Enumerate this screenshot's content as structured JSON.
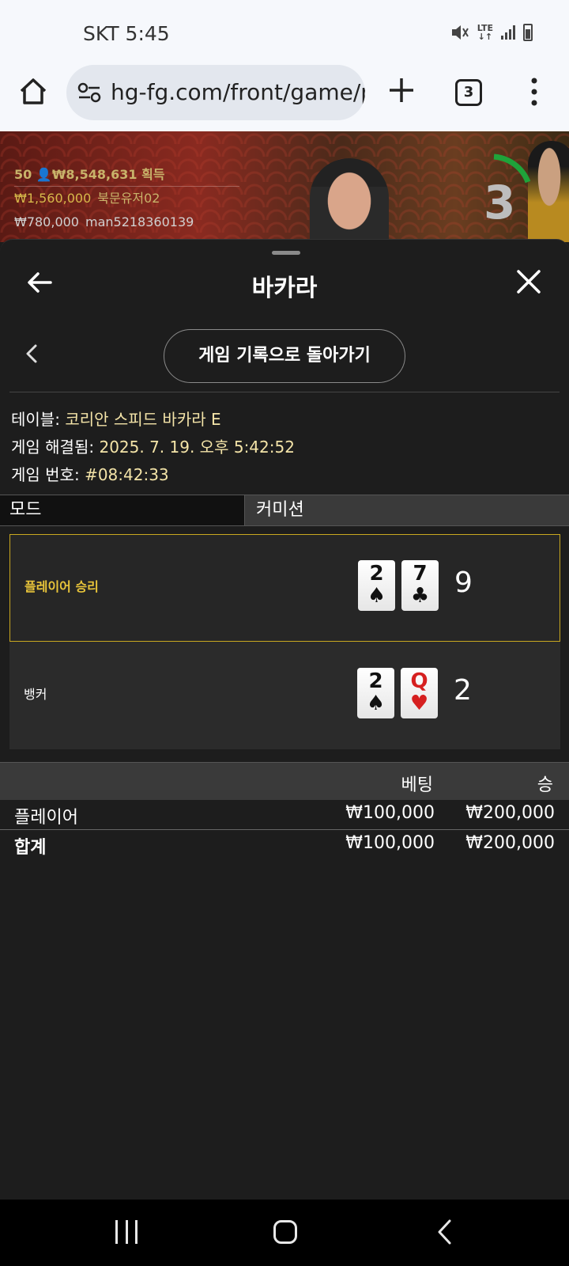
{
  "status": {
    "carrier_time": "SKT 5:45",
    "network": "LTE"
  },
  "browser": {
    "url": "hg-fg.com/front/game/p",
    "tab_count": "3"
  },
  "video": {
    "winners_total_count": "50",
    "winners_total_amount": "₩8,548,631",
    "winners_total_label": "획득",
    "winners": [
      {
        "amount": "₩1,560,000",
        "name": "북문유저02"
      },
      {
        "amount": "₩780,000",
        "name": "man5218360139"
      }
    ],
    "timer": "3"
  },
  "sheet": {
    "title": "바카라",
    "history_button": "게임 기록으로 돌아가기",
    "info": {
      "table_label": "테이블:",
      "table_value": "코리안 스피드 바카라 E",
      "resolved_label": "게임 해결됨:",
      "resolved_value": "2025. 7. 19. 오후 5:42:52",
      "number_label": "게임 번호:",
      "number_value": "#08:42:33"
    },
    "tabs": {
      "mode": "모드",
      "commission": "커미션"
    },
    "hands": {
      "player": {
        "label": "플레이어 승리",
        "cards": [
          {
            "rank": "2",
            "suit": "♠"
          },
          {
            "rank": "7",
            "suit": "♣"
          }
        ],
        "score": "9"
      },
      "banker": {
        "label": "뱅커",
        "cards": [
          {
            "rank": "2",
            "suit": "♠"
          },
          {
            "rank": "Q",
            "suit": "♥"
          }
        ],
        "score": "2"
      }
    },
    "bets": {
      "header_bet": "베팅",
      "header_win": "승",
      "rows": [
        {
          "name": "플레이어",
          "bet": "₩100,000",
          "win": "₩200,000"
        }
      ],
      "total": {
        "name": "합계",
        "bet": "₩100,000",
        "win": "₩200,000"
      }
    }
  },
  "colors": {
    "accent_gold": "#e8c43a",
    "timer_green": "#1fa33a"
  }
}
